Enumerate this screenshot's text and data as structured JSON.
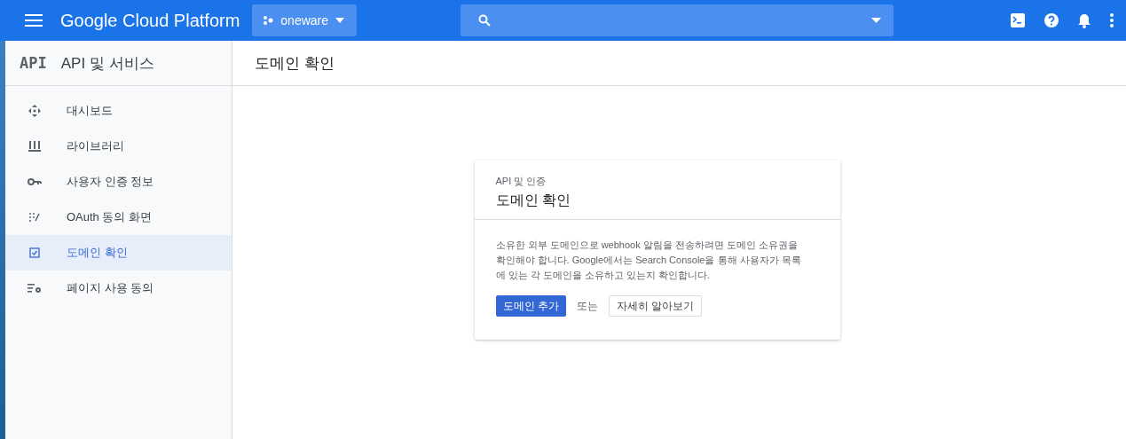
{
  "top_bar": {
    "title": "Google Cloud Platform",
    "project": "oneware"
  },
  "sidebar": {
    "title": "API 및 서비스",
    "logo": "API",
    "items": [
      {
        "label": "대시보드",
        "selected": false
      },
      {
        "label": "라이브러리",
        "selected": false
      },
      {
        "label": "사용자 인증 정보",
        "selected": false
      },
      {
        "label": "OAuth 동의 화면",
        "selected": false
      },
      {
        "label": "도메인 확인",
        "selected": true
      },
      {
        "label": "페이지 사용 동의",
        "selected": false
      }
    ]
  },
  "page": {
    "title": "도메인 확인"
  },
  "card": {
    "subtitle": "API 및 인증",
    "title": "도메인 확인",
    "text": "소유한 외부 도메인으로 webhook 알림을 전송하려면 도메인 소유권을 확인해야 합니다. Google에서는 Search Console을 통해 사용자가 목록에 있는 각 도메인을 소유하고 있는지 확인합니다.",
    "primary_button": "도메인 추가",
    "separator": "또는",
    "secondary_button": "자세히 알아보기"
  }
}
